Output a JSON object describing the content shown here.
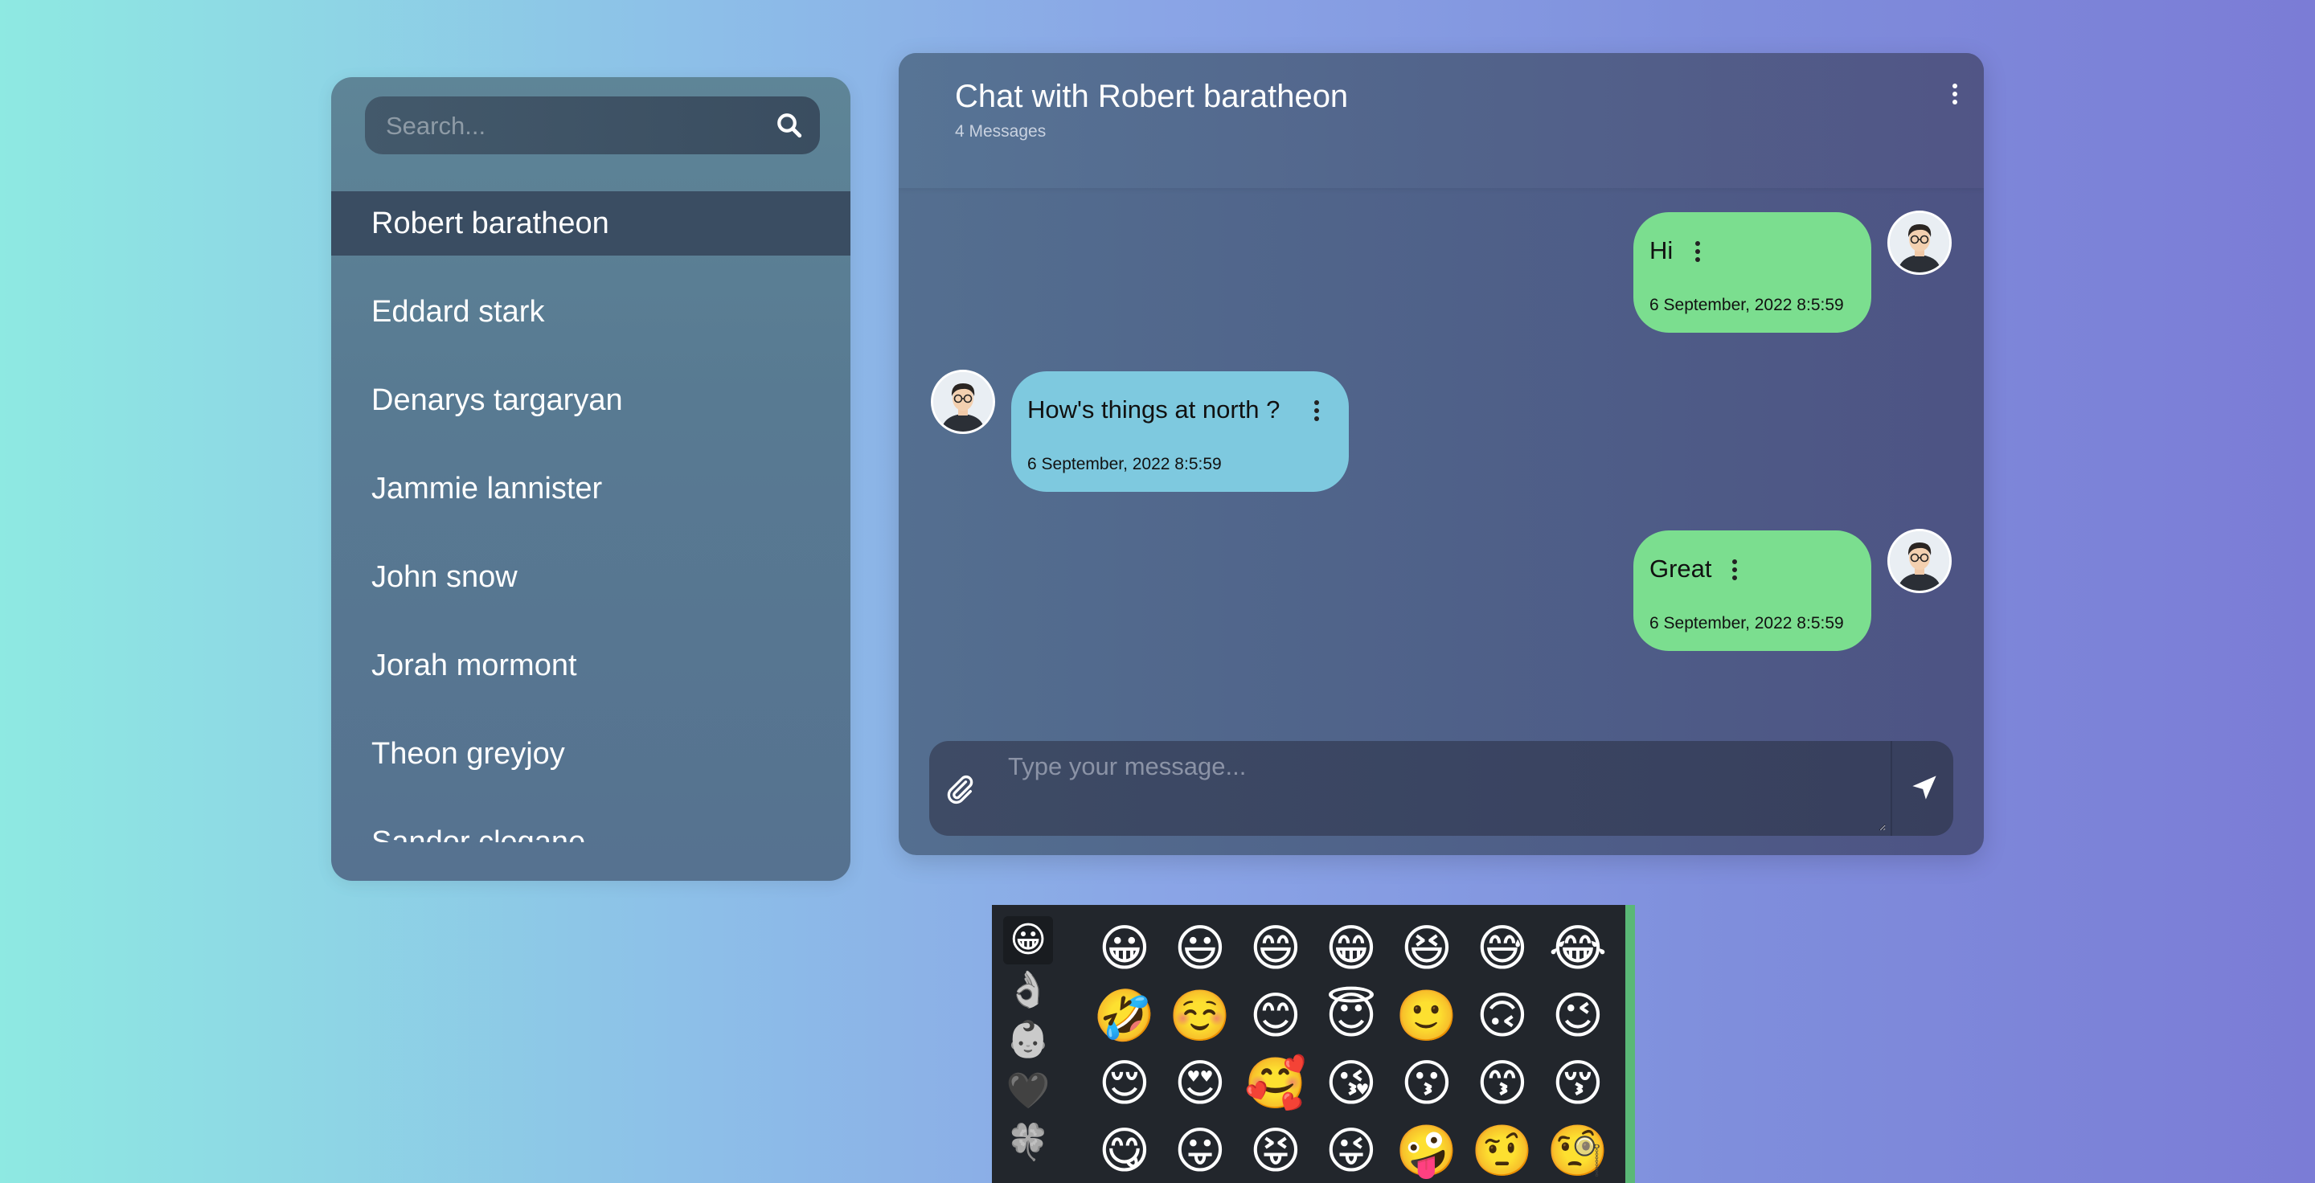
{
  "search": {
    "placeholder": "Search..."
  },
  "contacts": [
    {
      "name": "Robert baratheon",
      "active": true
    },
    {
      "name": "Eddard stark"
    },
    {
      "name": "Denarys targaryan"
    },
    {
      "name": "Jammie lannister"
    },
    {
      "name": "John snow"
    },
    {
      "name": "Jorah mormont"
    },
    {
      "name": "Theon greyjoy"
    },
    {
      "name": "Sandor clegane"
    }
  ],
  "chat": {
    "title": "Chat with Robert baratheon",
    "subtitle": "4 Messages",
    "messages": [
      {
        "text": "Hi",
        "time": "6 September, 2022 8:5:59",
        "sender": "me"
      },
      {
        "text": "How's things at north ?",
        "time": "6 September, 2022 8:5:59",
        "sender": "other"
      },
      {
        "text": "Great",
        "time": "6 September, 2022 8:5:59",
        "sender": "me"
      }
    ],
    "composer_placeholder": "Type your message..."
  },
  "emoji_picker": {
    "categories": [
      "😀",
      "👌",
      "👶",
      "🖤",
      "🍀"
    ],
    "emojis": [
      "😀",
      "😃",
      "😄",
      "😁",
      "😆",
      "😅",
      "😂",
      "🤣",
      "☺️",
      "😊",
      "😇",
      "🙂",
      "🙃",
      "😉",
      "😌",
      "😍",
      "🥰",
      "😘",
      "😗",
      "😙",
      "😚",
      "😋",
      "😛",
      "😝",
      "😜",
      "🤪",
      "🤨",
      "🧐"
    ]
  },
  "colors": {
    "own_bubble": "#7bde8f",
    "other_bubble": "#7ec9df",
    "active_contact": "#3a4d62"
  }
}
